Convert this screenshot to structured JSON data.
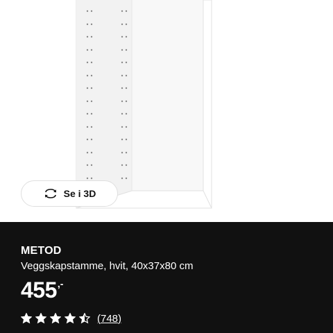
{
  "view3d": {
    "label": "Se i 3D",
    "icon": "rotate-3d-icon"
  },
  "product": {
    "name": "METOD",
    "description": "Veggskapstamme, hvit, 40x37x80 cm",
    "price": "455",
    "price_suffix": ",-",
    "rating": {
      "value": 4.5,
      "max": 5,
      "review_count": "(748)"
    }
  },
  "colors": {
    "panel_background": "#111111",
    "text": "#ffffff",
    "cabinet": "#ffffff",
    "cabinet_edge": "#e3e3e3"
  }
}
